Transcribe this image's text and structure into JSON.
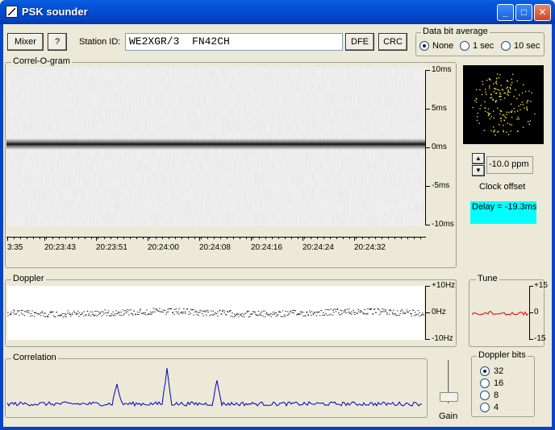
{
  "window": {
    "title": "PSK sounder"
  },
  "toolbar": {
    "mixer_label": "Mixer",
    "help_label": "?",
    "station_label": "Station ID:",
    "station_value": "WE2XGR/3  FN42CH",
    "dfe_label": "DFE",
    "crc_label": "CRC"
  },
  "data_bit_average": {
    "title": "Data bit average",
    "options": [
      "None",
      "1 sec",
      "10 sec"
    ],
    "selected": "None"
  },
  "correlogram": {
    "title": "Correl-O-gram",
    "y_ticks": [
      "10ms",
      "5ms",
      "0ms",
      "-5ms",
      "-10ms"
    ],
    "x_ticks": [
      "3:35",
      "20:23:43",
      "20:23:51",
      "20:24:00",
      "20:24:08",
      "20:24:16",
      "20:24:24",
      "20:24:32"
    ]
  },
  "clock": {
    "offset_value": "-10.0 ppm",
    "offset_label": "Clock offset"
  },
  "delay": {
    "text": "Delay = -19.3ms"
  },
  "doppler": {
    "title": "Doppler",
    "y_ticks": [
      "+10Hz",
      "0Hz",
      "-10Hz"
    ]
  },
  "tune": {
    "title": "Tune",
    "y_ticks": [
      "+15",
      "0",
      "-15"
    ]
  },
  "correlation": {
    "title": "Correlation"
  },
  "gain": {
    "label": "Gain"
  },
  "doppler_bits": {
    "title": "Doppler bits",
    "options": [
      "32",
      "16",
      "8",
      "4"
    ],
    "selected": "32"
  },
  "colors": {
    "title_bar": "#0454D8",
    "delay_bg": "#00FFFF",
    "correlation_line": "#0000C0",
    "tune_line": "#E00000",
    "scope_dots": "#E8E040"
  },
  "icons": {
    "app": "sounder-app-icon",
    "minimize": "minimize-icon",
    "maximize": "maximize-icon",
    "close": "close-icon"
  }
}
